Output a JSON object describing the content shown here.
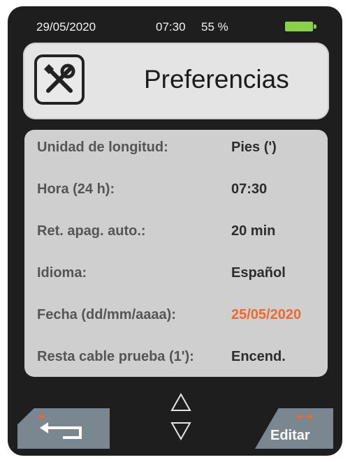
{
  "status": {
    "date": "29/05/2020",
    "time": "07:30",
    "battery_percent": "55 %",
    "battery_color": "#8ad14a"
  },
  "header": {
    "icon": "tools-icon",
    "title": "Preferencias"
  },
  "settings": [
    {
      "label": "Unidad de longitud:",
      "value": "Pies (')",
      "highlight": false
    },
    {
      "label": "Hora (24 h):",
      "value": "07:30",
      "highlight": false
    },
    {
      "label": "Ret. apag. auto.:",
      "value": "20 min",
      "highlight": false
    },
    {
      "label": "Idioma:",
      "value": "Español",
      "highlight": false
    },
    {
      "label": "Fecha (dd/mm/aaaa):",
      "value": "25/05/2020",
      "highlight": true
    },
    {
      "label": "Resta cable prueba (1'):",
      "value": "Encend.",
      "highlight": false
    }
  ],
  "footer": {
    "back_icon": "back-arrow-icon",
    "nav_up_icon": "arrow-up-icon",
    "nav_down_icon": "arrow-down-icon",
    "edit_label": "Editar"
  },
  "colors": {
    "highlight": "#ef6a2a",
    "softkey": "#7a8791",
    "device": "#1e1e1e"
  }
}
